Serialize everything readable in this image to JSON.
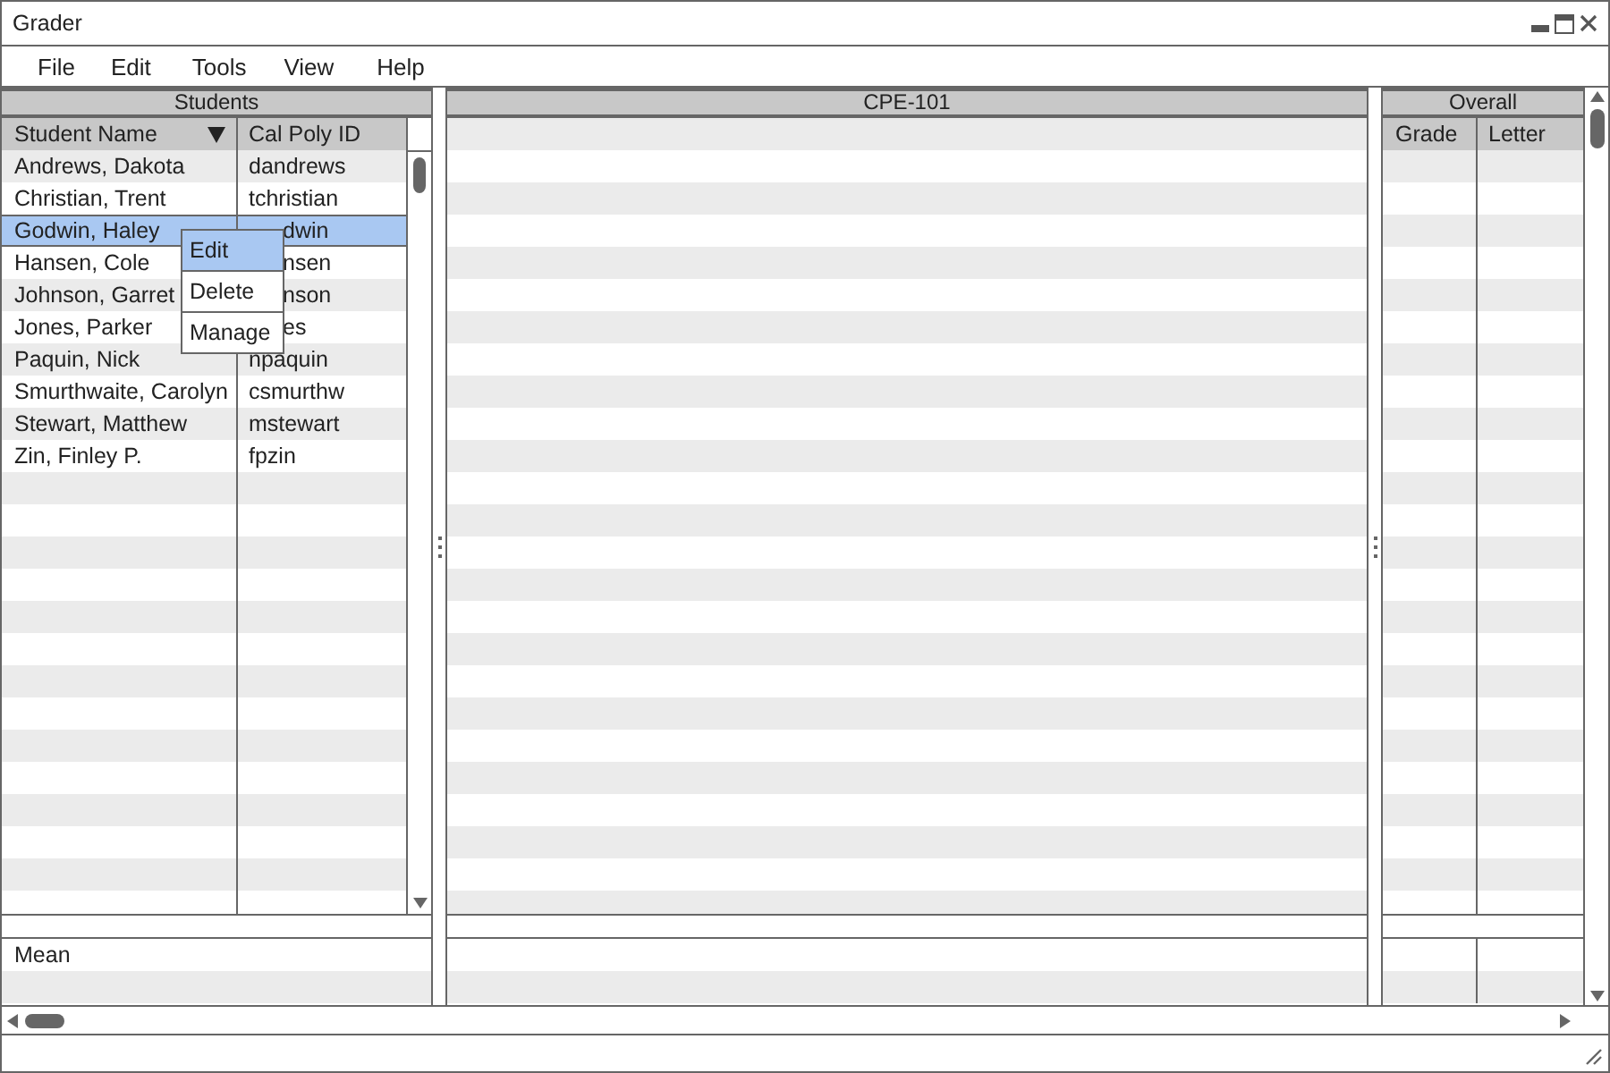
{
  "window": {
    "title": "Grader"
  },
  "menu_bar": [
    "File",
    "Edit",
    "Tools",
    "View",
    "Help"
  ],
  "students": {
    "title": "Students",
    "columns": [
      {
        "label": "Student Name",
        "sorted": true
      },
      {
        "label": "Cal Poly ID",
        "sorted": false
      }
    ],
    "rows": [
      {
        "name": "Andrews, Dakota",
        "cal_poly_id": "dandrews",
        "selected": false
      },
      {
        "name": "Christian, Trent",
        "cal_poly_id": "tchristian",
        "selected": false
      },
      {
        "name": "Godwin, Haley",
        "cal_poly_id": "dwin",
        "selected": true,
        "id_partly_hidden": true
      },
      {
        "name": "Hansen, Cole",
        "cal_poly_id": "nsen",
        "selected": false,
        "id_partly_hidden": true
      },
      {
        "name": "Johnson, Garret",
        "cal_poly_id": "nson",
        "selected": false,
        "id_partly_hidden": true
      },
      {
        "name": "Jones, Parker",
        "cal_poly_id": "es",
        "selected": false,
        "id_partly_hidden": true
      },
      {
        "name": "Paquin, Nick",
        "cal_poly_id": "npaquin",
        "selected": false
      },
      {
        "name": "Smurthwaite, Carolyn",
        "cal_poly_id": "csmurthw",
        "selected": false
      },
      {
        "name": "Stewart, Matthew",
        "cal_poly_id": "mstewart",
        "selected": false
      },
      {
        "name": "Zin, Finley P.",
        "cal_poly_id": "fpzin",
        "selected": false
      }
    ],
    "footer_label": "Mean"
  },
  "context_menu": [
    {
      "label": "Edit",
      "selected": true
    },
    {
      "label": "Delete",
      "selected": false
    },
    {
      "label": "Manage",
      "selected": false
    }
  ],
  "course": {
    "title": "CPE-101"
  },
  "overall": {
    "title": "Overall",
    "columns": [
      "Grade",
      "Letter"
    ]
  }
}
